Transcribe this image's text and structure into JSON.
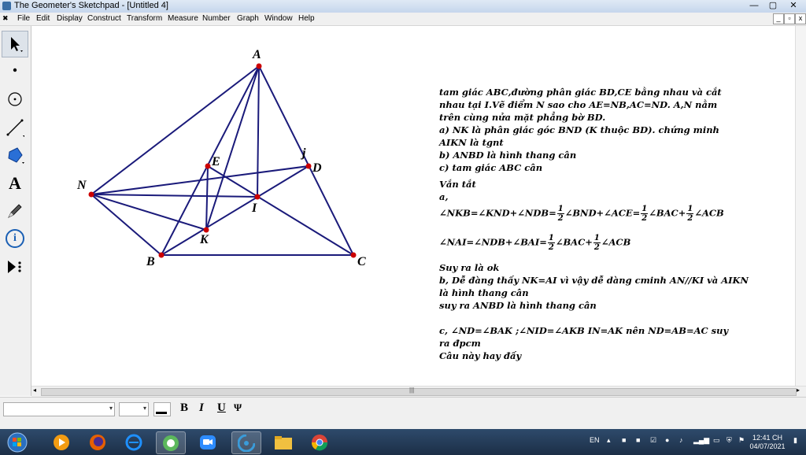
{
  "window": {
    "title": "The Geometer's Sketchpad - [Untitled 4]",
    "minimize": "—",
    "restore": "▢",
    "close": "✕"
  },
  "menu": [
    "File",
    "Edit",
    "Display",
    "Construct",
    "Transform",
    "Measure",
    "Number",
    "Graph",
    "Window",
    "Help"
  ],
  "tools": [
    "arrow-select-tool",
    "point-tool",
    "compass-tool",
    "straightedge-tool",
    "polygon-tool",
    "text-tool",
    "marker-tool",
    "information-tool",
    "custom-tool"
  ],
  "text_tool_glyph": "A",
  "info_tool_glyph": "i",
  "points": {
    "A": {
      "label": "A"
    },
    "B": {
      "label": "B"
    },
    "C": {
      "label": "C"
    },
    "N": {
      "label": "N"
    },
    "E": {
      "label": "E"
    },
    "D": {
      "label": "D"
    },
    "I": {
      "label": "I"
    },
    "K": {
      "label": "K"
    },
    "J": {
      "label": "j"
    }
  },
  "note": {
    "l1": "tam giác ABC,đường phân giác BD,CE bằng nhau và cắt",
    "l2": "nhau tại I.Vẽ điểm N sao cho AE=NB,AC=ND. A,N nằm",
    "l3": "trên cùng nửa mặt phẳng bờ BD.",
    "l4": "a) NK là phân giác góc BND (K thuộc BD). chứng minh",
    "l5": "AIKN là tgnt",
    "l6": "b) ANBD là hình thang cân",
    "l7": "c) tam giác ABC cân",
    "l8": "Vắn tắt",
    "l9": "a,",
    "eq1a": "∠NKB=∠KND+∠NDB=",
    "eq1b": "∠BND+∠ACE=",
    "eq1c": "∠BAC+",
    "eq1d": "∠ACB",
    "eq2a": "∠NAI=∠NDB+∠BAI=",
    "eq2b": "∠BAC+",
    "eq2c": "∠ACB",
    "frac_num": "1",
    "frac_den": "2",
    "l10": "Suy ra là ok",
    "l11": "b, Dễ đàng thấy NK=AI  vì vậy dễ dàng cminh AN//KI và AIKN",
    "l12": "là hình thang cân",
    "l13": "suy ra ANBD là hình thang cân",
    "l14": "c,  ∠ND=∠BAK ;∠NID=∠AKB IN=AK nên ND=AB=AC suy",
    "l15": "ra đpcm",
    "l16": "Câu này hay đấy"
  },
  "text_palette": {
    "bold": "B",
    "italic": "I",
    "underline": "U",
    "symbol": "Ψ"
  },
  "taskbar": {
    "lang": "EN",
    "time": "12:41 CH",
    "date": "04/07/2021"
  },
  "colors": {
    "segment": "#1a1a7a",
    "point": "#cc0000"
  }
}
